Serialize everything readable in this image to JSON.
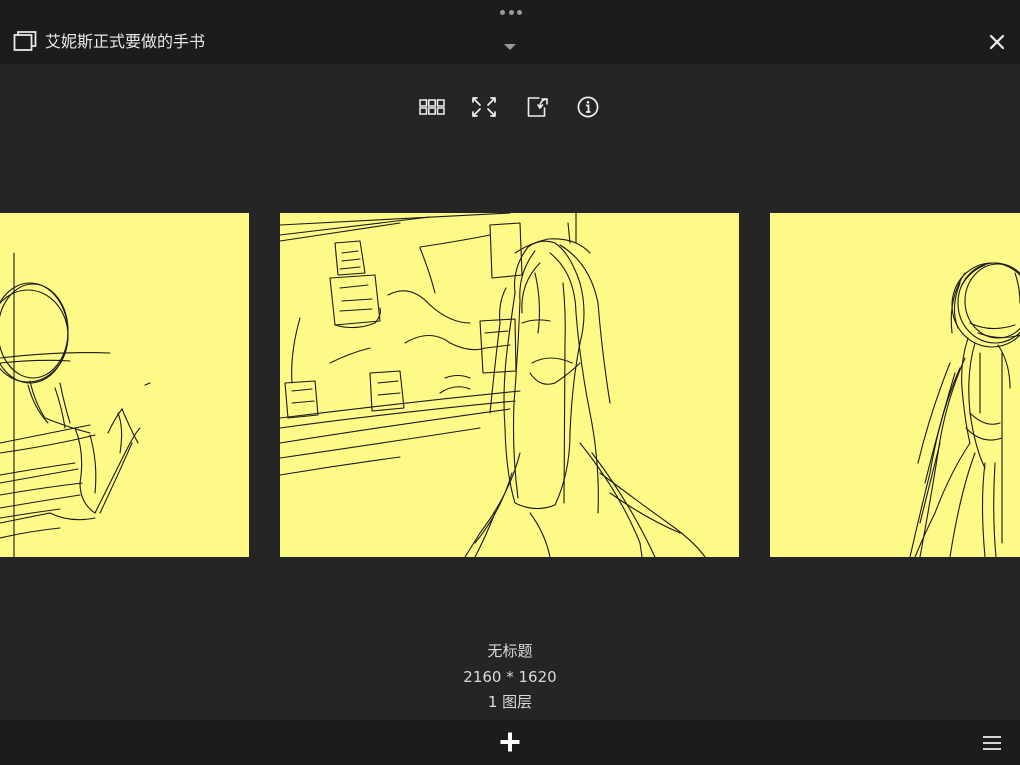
{
  "header": {
    "title": "艾妮斯正式要做的手书"
  },
  "toolbar": {
    "icons": [
      "grid-icon",
      "expand-icon",
      "export-icon",
      "info-icon"
    ]
  },
  "artwork": {
    "name": "无标题",
    "dimensions": "2160 * 1620",
    "layers": "1 图层"
  },
  "colors": {
    "background": "#252525",
    "bar": "#1c1c1c",
    "canvas": "#fdfa88",
    "sketch": "#1a1a1a"
  }
}
